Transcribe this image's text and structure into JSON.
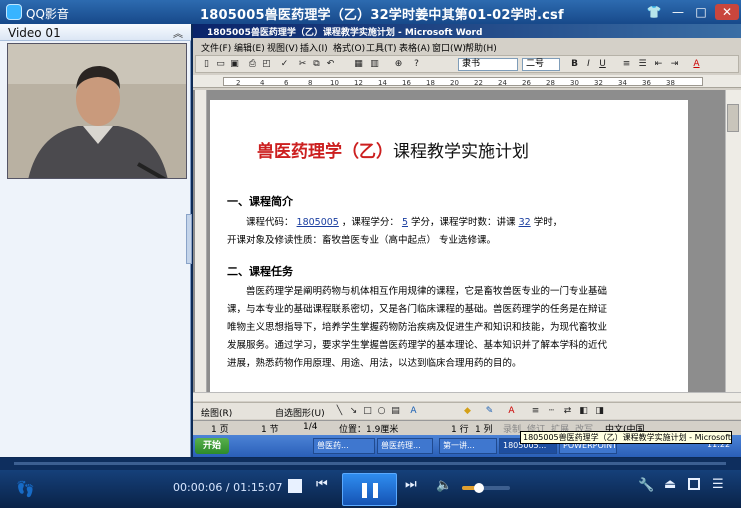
{
  "player": {
    "app_name": "QQ影音",
    "file_title": "1805005兽医药理学（乙）32学时姜中其第01-02学时.csf",
    "controls": {
      "skin": "👕",
      "minimize": "—",
      "maximize": "□",
      "close": "✕"
    }
  },
  "playlist": {
    "header_label": "Video 01",
    "collapse_glyph": "︽"
  },
  "word": {
    "title": "1805005兽医药理学（乙）课程教学实施计划 - Microsoft Word",
    "menu": [
      "文件(F)",
      "编辑(E)",
      "视图(V)",
      "插入(I)",
      "格式(O)",
      "工具(T)",
      "表格(A)",
      "窗口(W)",
      "帮助(H)"
    ],
    "font_name": "隶书",
    "font_size": "二号",
    "ruler_numbers": [
      "2",
      "4",
      "6",
      "8",
      "10",
      "12",
      "14",
      "16",
      "18",
      "20",
      "22",
      "24",
      "26",
      "28",
      "30",
      "32",
      "34",
      "36",
      "38"
    ],
    "document": {
      "heading_red": "兽医药理学（乙）",
      "heading_black": "课程教学实施计划",
      "section1_title": "一、课程简介",
      "course_code_label": "课程代码：",
      "course_code": "1805005",
      "credit_label": "，课程学分：",
      "credit": "5",
      "hours_label": "学分，课程学时数：讲课",
      "hours": "32",
      "hours_unit": "学时，",
      "audience_line": "开课对象及修读性质：畜牧兽医专业（高中起点）    专业选修课。",
      "section2_title": "二、课程任务",
      "para_lines": [
        "兽医药理学是阐明药物与机体相互作用规律的课程，它是畜牧兽医专业的一门专业基础",
        "课，与本专业的基础课程联系密切，又是各门临床课程的基础。兽医药理学的任务是在辩证",
        "唯物主义思想指导下，培养学生掌握药物防治疾病及促进生产和知识和技能，为现代畜牧业",
        "发展服务。通过学习，要求学生掌握兽医药理学的基本理论、基本知识并了解本学科的近代",
        "进展，熟悉药物作用原理、用途、用法，以达到临床合理用药的目的。"
      ]
    },
    "draw_toolbar": {
      "draw_label": "绘图(R)",
      "autoshape_label": "自选图形(U)"
    },
    "status": {
      "page": "1 页",
      "section": "1 节",
      "page_of": "1/4",
      "position": "位置：1.9厘米",
      "line": "1 行",
      "column": "1 列",
      "rec": "录制",
      "trk": "修订",
      "ext": "扩展",
      "ovr": "改写",
      "lang": "中文(中国"
    },
    "taskbar": {
      "start": "开始",
      "tasks": [
        "兽医药...",
        "兽医药理...",
        "第一讲...",
        "1805005...",
        "POWERPOINT..."
      ],
      "clock": "11:22"
    },
    "tooltip": "1805005兽医药理学（乙）课程教学实施计划 - Microsoft Word"
  },
  "playback": {
    "current_time": "00:00:06",
    "total_time": "01:15:07",
    "progress_fraction": 0.001,
    "volume_fraction": 0.35
  },
  "icons": [
    "qq-player-logo-icon",
    "stop-icon",
    "previous-icon",
    "pause-icon",
    "next-icon",
    "volume-icon",
    "footprint-icon",
    "tools-icon",
    "eject-icon",
    "playlist-icon"
  ]
}
